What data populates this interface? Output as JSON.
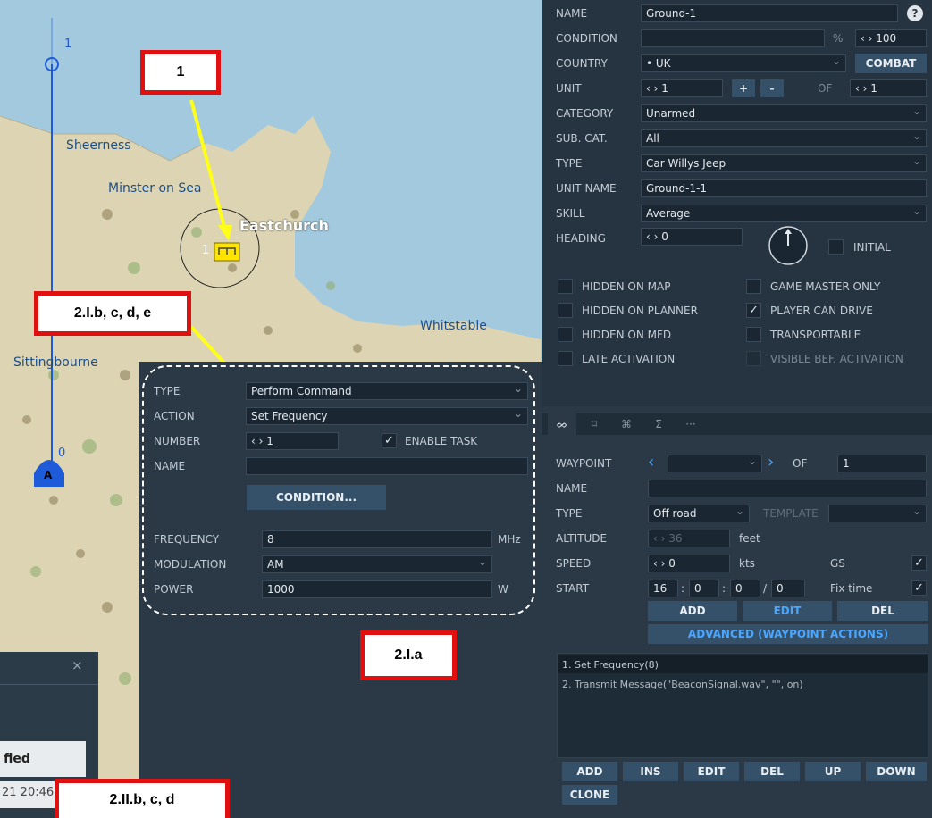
{
  "map": {
    "places": [
      "Sheerness",
      "Minster on Sea",
      "Eastchurch",
      "Whitstable",
      "Sittingbourne"
    ],
    "route_waypoint_top": "1",
    "route_waypoint_bottom": "0",
    "airfield_marker": "A",
    "unit_number": "1"
  },
  "unit_panel": {
    "name_label": "NAME",
    "name_value": "Ground-1",
    "help": "?",
    "condition_label": "CONDITION",
    "condition_value": "",
    "percent": "%",
    "condition_pct": "‹ › 100",
    "country_label": "COUNTRY",
    "country_value": "• UK",
    "combat": "COMBAT",
    "unit_label": "UNIT",
    "unit_value": "‹ › 1",
    "plus": "+",
    "minus": "-",
    "of_label": "OF",
    "unit_of_value": "‹ › 1",
    "category_label": "CATEGORY",
    "category_value": "Unarmed",
    "subcat_label": "SUB. CAT.",
    "subcat_value": "All",
    "type_label": "TYPE",
    "type_value": "Car Willys Jeep",
    "unitname_label": "UNIT NAME",
    "unitname_value": "Ground-1-1",
    "skill_label": "SKILL",
    "skill_value": "Average",
    "heading_label": "HEADING",
    "heading_value": "‹ › 0",
    "initial": "INITIAL",
    "checkboxes": {
      "hidden_map": "HIDDEN ON MAP",
      "game_master": "GAME MASTER ONLY",
      "hidden_planner": "HIDDEN ON PLANNER",
      "player_drive": "PLAYER CAN DRIVE",
      "hidden_mfd": "HIDDEN ON MFD",
      "transportable": "TRANSPORTABLE",
      "late_activation": "LATE ACTIVATION",
      "visible_before": "VISIBLE BEF. ACTIVATION"
    }
  },
  "route_panel": {
    "tabs": [
      "ᨖ",
      "⌑",
      "⌘",
      "Σ",
      "···"
    ],
    "waypoint_label": "WAYPOINT",
    "of_label": "OF",
    "waypoint_of": "1",
    "name_label": "NAME",
    "type_label": "TYPE",
    "type_value": "Off road",
    "template_label": "TEMPLATE",
    "altitude_label": "ALTITUDE",
    "altitude_value": "‹ › 36",
    "altitude_unit": "feet",
    "speed_label": "SPEED",
    "speed_value": "‹ › 0",
    "speed_unit": "kts",
    "gs": "GS",
    "start_label": "START",
    "start_h": "16",
    "start_m": "0",
    "start_s": "0",
    "start_d": "0",
    "fix_time": "Fix time",
    "add": "ADD",
    "edit": "EDIT",
    "del": "DEL",
    "advanced": "ADVANCED (WAYPOINT ACTIONS)",
    "actions": [
      "1. Set Frequency(8)",
      "2. Transmit Message(\"BeaconSignal.wav\", \"\", on)"
    ],
    "bottom_buttons": [
      "ADD",
      "INS",
      "EDIT",
      "DEL",
      "UP",
      "DOWN"
    ],
    "clone": "CLONE"
  },
  "action_panel": {
    "type_label": "TYPE",
    "type_value": "Perform Command",
    "action_label": "ACTION",
    "action_value": "Set Frequency",
    "number_label": "NUMBER",
    "number_value": "‹ › 1",
    "enable_task": "ENABLE TASK",
    "name_label": "NAME",
    "condition_btn": "CONDITION...",
    "frequency_label": "FREQUENCY",
    "frequency_value": "8",
    "frequency_unit": "MHz",
    "modulation_label": "MODULATION",
    "modulation_value": "AM",
    "power_label": "POWER",
    "power_value": "1000",
    "power_unit": "W"
  },
  "dialog": {
    "close": "×",
    "column": "fied",
    "timestamp": "21 20:46"
  },
  "callouts": {
    "c1": "1",
    "c2": "2.I.b, c, d, e",
    "c3": "2.I.a",
    "c4": "2.II.b, c, d"
  }
}
